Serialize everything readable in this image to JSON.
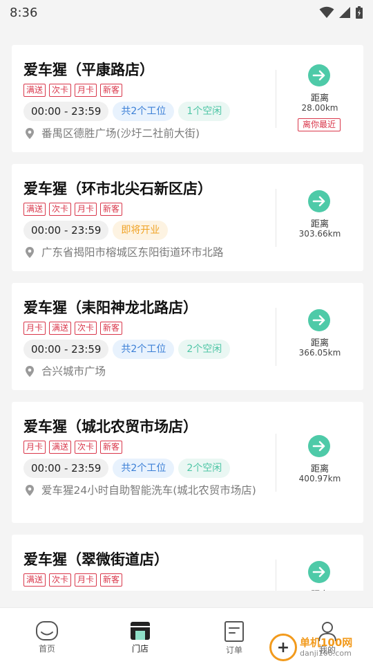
{
  "status_bar": {
    "time": "8:36"
  },
  "stores": [
    {
      "name": "爱车猩（平康路店）",
      "tags": [
        "满送",
        "次卡",
        "月卡",
        "新客"
      ],
      "hours": "00:00 - 23:59",
      "chips": [
        {
          "text": "共2个工位",
          "style": "blue"
        },
        {
          "text": "1个空闲",
          "style": "teal"
        }
      ],
      "address": "番禺区德胜广场(沙圩二社前大街)",
      "distance_label": "距离",
      "distance": "28.00km",
      "badge": "离你最近"
    },
    {
      "name": "爱车猩（环市北尖石新区店）",
      "tags": [
        "满送",
        "次卡",
        "月卡",
        "新客"
      ],
      "hours": "00:00 - 23:59",
      "chips": [
        {
          "text": "即将开业",
          "style": "orange"
        }
      ],
      "address": "广东省揭阳市榕城区东阳街道环市北路",
      "distance_label": "距离",
      "distance": "303.66km"
    },
    {
      "name": "爱车猩（耒阳神龙北路店）",
      "tags": [
        "月卡",
        "满送",
        "次卡",
        "新客"
      ],
      "hours": "00:00 - 23:59",
      "chips": [
        {
          "text": "共2个工位",
          "style": "blue"
        },
        {
          "text": "2个空闲",
          "style": "teal"
        }
      ],
      "address": "合兴城市广场",
      "distance_label": "距离",
      "distance": "366.05km"
    },
    {
      "name": "爱车猩（城北农贸市场店）",
      "tags": [
        "月卡",
        "满送",
        "次卡",
        "新客"
      ],
      "hours": "00:00 - 23:59",
      "chips": [
        {
          "text": "共2个工位",
          "style": "blue"
        },
        {
          "text": "2个空闲",
          "style": "teal"
        }
      ],
      "address": "爱车猩24小时自助智能洗车(城北农贸市场店)",
      "distance_label": "距离",
      "distance": "400.97km"
    },
    {
      "name": "爱车猩（翠微街道店）",
      "tags": [
        "满送",
        "次卡",
        "月卡",
        "新客"
      ],
      "distance_label": "距离"
    }
  ],
  "tabbar": {
    "items": [
      {
        "label": "首页",
        "icon": "home-icon",
        "active": false
      },
      {
        "label": "门店",
        "icon": "store-icon",
        "active": true
      },
      {
        "label": "订单",
        "icon": "order-icon",
        "active": false
      },
      {
        "label": "我的",
        "icon": "profile-icon",
        "active": false
      }
    ]
  },
  "watermark": {
    "main": "单机100网",
    "sub": "danji100.com"
  },
  "colors": {
    "accent_green": "#4ecaa8",
    "tag_red": "#d9364a",
    "chip_blue": "#3b7fd6",
    "chip_teal": "#4fc6a6",
    "chip_orange": "#f0a326"
  }
}
